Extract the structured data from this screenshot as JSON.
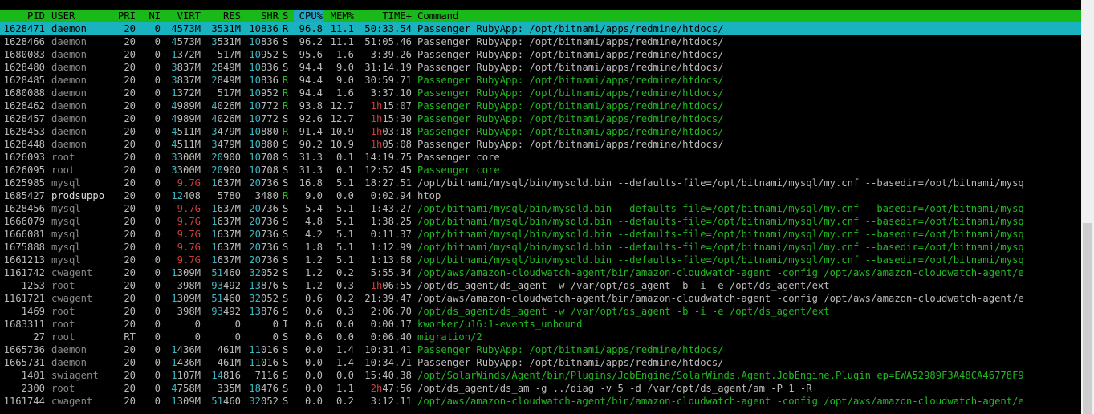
{
  "columns": [
    "PID",
    "USER",
    "PRI",
    "NI",
    "VIRT",
    "RES",
    "SHR",
    "S",
    "CPU%",
    "MEM%",
    "TIME+",
    "Command"
  ],
  "colors": {
    "header_bg": "#19b919",
    "selected_bg": "#19b3bf",
    "sort_column_bg": "#1fa8c4",
    "text": "#bbbbbb",
    "dim_user": "#8a8a8a",
    "thread_green": "#22b922",
    "mega_cyan": "#3bb7c4",
    "giga_red": "#d03c3c",
    "running_green": "#22b922"
  },
  "processes": [
    {
      "pid": "1628471",
      "user": "daemon",
      "pri": "20",
      "ni": "0",
      "virt": "4573M",
      "res": "3531M",
      "shr": "10836",
      "s": "R",
      "cpu": "96.8",
      "mem": "11.1",
      "time": "50:33.54",
      "cmd": "Passenger RubyApp: /opt/bitnami/apps/redmine/htdocs/",
      "selected": true
    },
    {
      "pid": "1628466",
      "user": "daemon",
      "pri": "20",
      "ni": "0",
      "virt": "4573M",
      "res": "3531M",
      "shr": "10836",
      "s": "S",
      "cpu": "96.2",
      "mem": "11.1",
      "time": "51:05.46",
      "cmd": "Passenger RubyApp: /opt/bitnami/apps/redmine/htdocs/"
    },
    {
      "pid": "1680083",
      "user": "daemon",
      "pri": "20",
      "ni": "0",
      "virt": "1372M",
      "res": "517M",
      "shr": "10952",
      "s": "S",
      "cpu": "95.6",
      "mem": "1.6",
      "time": "3:39.26",
      "cmd": "Passenger RubyApp: /opt/bitnami/apps/redmine/htdocs/"
    },
    {
      "pid": "1628480",
      "user": "daemon",
      "pri": "20",
      "ni": "0",
      "virt": "3837M",
      "res": "2849M",
      "shr": "10836",
      "s": "S",
      "cpu": "94.4",
      "mem": "9.0",
      "time": "31:14.19",
      "cmd": "Passenger RubyApp: /opt/bitnami/apps/redmine/htdocs/"
    },
    {
      "pid": "1628485",
      "user": "daemon",
      "pri": "20",
      "ni": "0",
      "virt": "3837M",
      "res": "2849M",
      "shr": "10836",
      "s": "R",
      "cpu": "94.4",
      "mem": "9.0",
      "time": "30:59.71",
      "cmd": "Passenger RubyApp: /opt/bitnami/apps/redmine/htdocs/",
      "thread": true
    },
    {
      "pid": "1680088",
      "user": "daemon",
      "pri": "20",
      "ni": "0",
      "virt": "1372M",
      "res": "517M",
      "shr": "10952",
      "s": "R",
      "cpu": "94.4",
      "mem": "1.6",
      "time": "3:37.10",
      "cmd": "Passenger RubyApp: /opt/bitnami/apps/redmine/htdocs/",
      "thread": true
    },
    {
      "pid": "1628462",
      "user": "daemon",
      "pri": "20",
      "ni": "0",
      "virt": "4989M",
      "res": "4026M",
      "shr": "10772",
      "s": "R",
      "cpu": "93.8",
      "mem": "12.7",
      "time": "1h15:07",
      "cmd": "Passenger RubyApp: /opt/bitnami/apps/redmine/htdocs/",
      "thread": true
    },
    {
      "pid": "1628457",
      "user": "daemon",
      "pri": "20",
      "ni": "0",
      "virt": "4989M",
      "res": "4026M",
      "shr": "10772",
      "s": "S",
      "cpu": "92.6",
      "mem": "12.7",
      "time": "1h15:30",
      "cmd": "Passenger RubyApp: /opt/bitnami/apps/redmine/htdocs/",
      "thread": true
    },
    {
      "pid": "1628453",
      "user": "daemon",
      "pri": "20",
      "ni": "0",
      "virt": "4511M",
      "res": "3479M",
      "shr": "10880",
      "s": "R",
      "cpu": "91.4",
      "mem": "10.9",
      "time": "1h03:18",
      "cmd": "Passenger RubyApp: /opt/bitnami/apps/redmine/htdocs/",
      "thread": true
    },
    {
      "pid": "1628448",
      "user": "daemon",
      "pri": "20",
      "ni": "0",
      "virt": "4511M",
      "res": "3479M",
      "shr": "10880",
      "s": "S",
      "cpu": "90.2",
      "mem": "10.9",
      "time": "1h05:08",
      "cmd": "Passenger RubyApp: /opt/bitnami/apps/redmine/htdocs/"
    },
    {
      "pid": "1626093",
      "user": "root",
      "pri": "20",
      "ni": "0",
      "virt": "3300M",
      "res": "20900",
      "shr": "10708",
      "s": "S",
      "cpu": "31.3",
      "mem": "0.1",
      "time": "14:19.75",
      "cmd": "Passenger core"
    },
    {
      "pid": "1626095",
      "user": "root",
      "pri": "20",
      "ni": "0",
      "virt": "3300M",
      "res": "20900",
      "shr": "10708",
      "s": "S",
      "cpu": "31.3",
      "mem": "0.1",
      "time": "12:52.45",
      "cmd": "Passenger core",
      "thread": true
    },
    {
      "pid": "1625985",
      "user": "mysql",
      "pri": "20",
      "ni": "0",
      "virt": "9.7G",
      "res": "1637M",
      "shr": "20736",
      "s": "S",
      "cpu": "16.8",
      "mem": "5.1",
      "time": "18:27.51",
      "cmd": "/opt/bitnami/mysql/bin/mysqld.bin --defaults-file=/opt/bitnami/mysql/my.cnf --basedir=/opt/bitnami/mysq"
    },
    {
      "pid": "1685427",
      "user": "prodsuppo",
      "pri": "20",
      "ni": "0",
      "virt": "12408",
      "res": "5780",
      "shr": "3480",
      "s": "R",
      "cpu": "9.0",
      "mem": "0.0",
      "time": "0:02.94",
      "cmd": "htop",
      "bright_user": true
    },
    {
      "pid": "1628456",
      "user": "mysql",
      "pri": "20",
      "ni": "0",
      "virt": "9.7G",
      "res": "1637M",
      "shr": "20736",
      "s": "S",
      "cpu": "5.4",
      "mem": "5.1",
      "time": "1:43.27",
      "cmd": "/opt/bitnami/mysql/bin/mysqld.bin --defaults-file=/opt/bitnami/mysql/my.cnf --basedir=/opt/bitnami/mysq",
      "thread": true
    },
    {
      "pid": "1666079",
      "user": "mysql",
      "pri": "20",
      "ni": "0",
      "virt": "9.7G",
      "res": "1637M",
      "shr": "20736",
      "s": "S",
      "cpu": "4.8",
      "mem": "5.1",
      "time": "1:38.25",
      "cmd": "/opt/bitnami/mysql/bin/mysqld.bin --defaults-file=/opt/bitnami/mysql/my.cnf --basedir=/opt/bitnami/mysq",
      "thread": true
    },
    {
      "pid": "1666081",
      "user": "mysql",
      "pri": "20",
      "ni": "0",
      "virt": "9.7G",
      "res": "1637M",
      "shr": "20736",
      "s": "S",
      "cpu": "4.2",
      "mem": "5.1",
      "time": "0:11.37",
      "cmd": "/opt/bitnami/mysql/bin/mysqld.bin --defaults-file=/opt/bitnami/mysql/my.cnf --basedir=/opt/bitnami/mysq",
      "thread": true
    },
    {
      "pid": "1675888",
      "user": "mysql",
      "pri": "20",
      "ni": "0",
      "virt": "9.7G",
      "res": "1637M",
      "shr": "20736",
      "s": "S",
      "cpu": "1.8",
      "mem": "5.1",
      "time": "1:12.99",
      "cmd": "/opt/bitnami/mysql/bin/mysqld.bin --defaults-file=/opt/bitnami/mysql/my.cnf --basedir=/opt/bitnami/mysq",
      "thread": true
    },
    {
      "pid": "1661213",
      "user": "mysql",
      "pri": "20",
      "ni": "0",
      "virt": "9.7G",
      "res": "1637M",
      "shr": "20736",
      "s": "S",
      "cpu": "1.2",
      "mem": "5.1",
      "time": "1:13.68",
      "cmd": "/opt/bitnami/mysql/bin/mysqld.bin --defaults-file=/opt/bitnami/mysql/my.cnf --basedir=/opt/bitnami/mysq",
      "thread": true
    },
    {
      "pid": "1161742",
      "user": "cwagent",
      "pri": "20",
      "ni": "0",
      "virt": "1309M",
      "res": "51460",
      "shr": "32052",
      "s": "S",
      "cpu": "1.2",
      "mem": "0.2",
      "time": "5:55.34",
      "cmd": "/opt/aws/amazon-cloudwatch-agent/bin/amazon-cloudwatch-agent -config /opt/aws/amazon-cloudwatch-agent/e",
      "thread": true
    },
    {
      "pid": "1253",
      "user": "root",
      "pri": "20",
      "ni": "0",
      "virt": "398M",
      "res": "93492",
      "shr": "13876",
      "s": "S",
      "cpu": "1.2",
      "mem": "0.3",
      "time": "1h06:55",
      "cmd": "/opt/ds_agent/ds_agent -w /var/opt/ds_agent -b -i -e /opt/ds_agent/ext"
    },
    {
      "pid": "1161721",
      "user": "cwagent",
      "pri": "20",
      "ni": "0",
      "virt": "1309M",
      "res": "51460",
      "shr": "32052",
      "s": "S",
      "cpu": "0.6",
      "mem": "0.2",
      "time": "21:39.47",
      "cmd": "/opt/aws/amazon-cloudwatch-agent/bin/amazon-cloudwatch-agent -config /opt/aws/amazon-cloudwatch-agent/e"
    },
    {
      "pid": "1469",
      "user": "root",
      "pri": "20",
      "ni": "0",
      "virt": "398M",
      "res": "93492",
      "shr": "13876",
      "s": "S",
      "cpu": "0.6",
      "mem": "0.3",
      "time": "2:06.70",
      "cmd": "/opt/ds_agent/ds_agent -w /var/opt/ds_agent -b -i -e /opt/ds_agent/ext",
      "thread": true
    },
    {
      "pid": "1683311",
      "user": "root",
      "pri": "20",
      "ni": "0",
      "virt": "0",
      "res": "0",
      "shr": "0",
      "s": "I",
      "cpu": "0.6",
      "mem": "0.0",
      "time": "0:00.17",
      "cmd": "kworker/u16:1-events_unbound",
      "thread": true
    },
    {
      "pid": "27",
      "user": "root",
      "pri": "RT",
      "ni": "0",
      "virt": "0",
      "res": "0",
      "shr": "0",
      "s": "S",
      "cpu": "0.6",
      "mem": "0.0",
      "time": "0:06.40",
      "cmd": "migration/2",
      "thread": true
    },
    {
      "pid": "1665736",
      "user": "daemon",
      "pri": "20",
      "ni": "0",
      "virt": "1436M",
      "res": "461M",
      "shr": "11016",
      "s": "S",
      "cpu": "0.0",
      "mem": "1.4",
      "time": "10:31.41",
      "cmd": "Passenger RubyApp: /opt/bitnami/apps/redmine/htdocs/",
      "thread": true
    },
    {
      "pid": "1665731",
      "user": "daemon",
      "pri": "20",
      "ni": "0",
      "virt": "1436M",
      "res": "461M",
      "shr": "11016",
      "s": "S",
      "cpu": "0.0",
      "mem": "1.4",
      "time": "10:34.71",
      "cmd": "Passenger RubyApp: /opt/bitnami/apps/redmine/htdocs/"
    },
    {
      "pid": "1401",
      "user": "swiagent",
      "pri": "20",
      "ni": "0",
      "virt": "1107M",
      "res": "14816",
      "shr": "7116",
      "s": "S",
      "cpu": "0.0",
      "mem": "0.0",
      "time": "15:40.38",
      "cmd": "/opt/SolarWinds/Agent/bin/Plugins/JobEngine/SolarWinds.Agent.JobEngine.Plugin ep=EWA52989F3A48CA46778F9",
      "thread": true
    },
    {
      "pid": "2300",
      "user": "root",
      "pri": "20",
      "ni": "0",
      "virt": "4758M",
      "res": "335M",
      "shr": "18476",
      "s": "S",
      "cpu": "0.0",
      "mem": "1.1",
      "time": "2h47:56",
      "cmd": "/opt/ds_agent/ds_am -g ../diag -v 5 -d /var/opt/ds_agent/am -P 1 -R"
    },
    {
      "pid": "1161744",
      "user": "cwagent",
      "pri": "20",
      "ni": "0",
      "virt": "1309M",
      "res": "51460",
      "shr": "32052",
      "s": "S",
      "cpu": "0.0",
      "mem": "0.2",
      "time": "3:12.11",
      "cmd": "/opt/aws/amazon-cloudwatch-agent/bin/amazon-cloudwatch-agent -config /opt/aws/amazon-cloudwatch-agent/e",
      "thread": true
    }
  ]
}
